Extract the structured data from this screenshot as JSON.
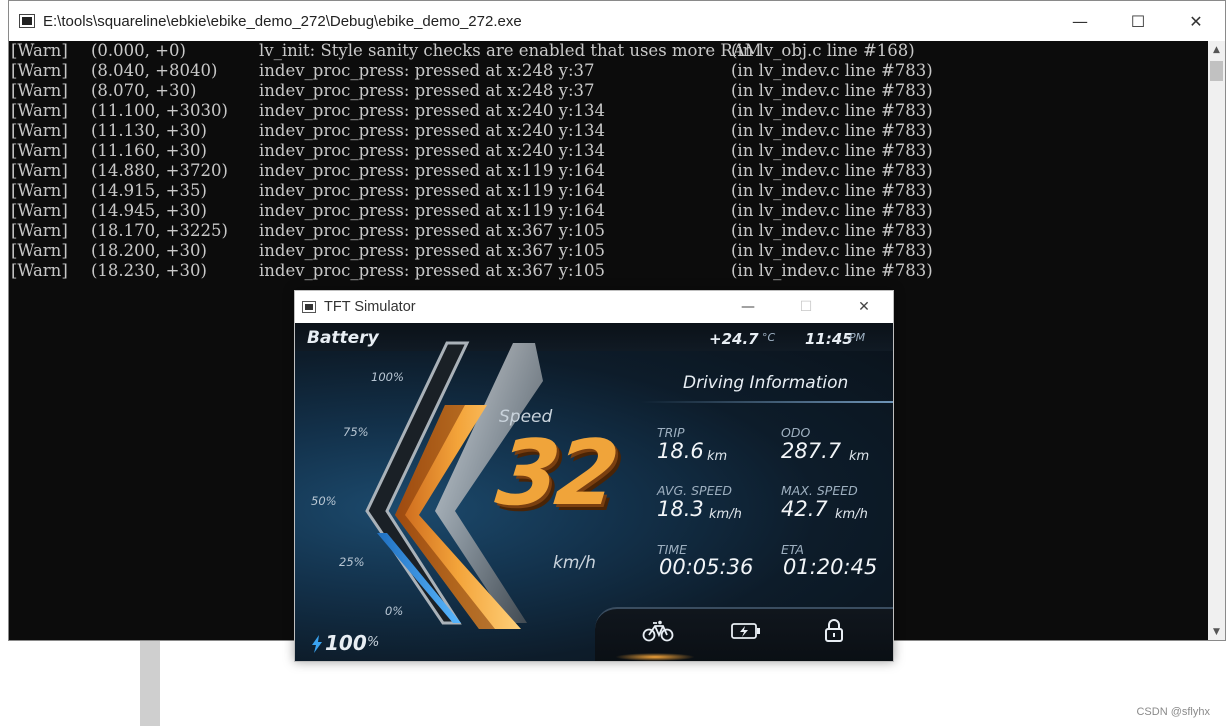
{
  "console": {
    "title": "E:\\tools\\squareline\\ebkie\\ebike_demo_272\\Debug\\ebike_demo_272.exe",
    "window_buttons": {
      "minimize": "—",
      "maximize": "☐",
      "close": "✕"
    },
    "lines": [
      {
        "level": "[Warn]",
        "time": "(0.000, +0)",
        "msg": "lv_init: Style sanity checks are enabled that uses more RAM",
        "loc": "(in lv_obj.c line #168)"
      },
      {
        "level": "[Warn]",
        "time": "(8.040, +8040)",
        "msg": "indev_proc_press: pressed at x:248 y:37",
        "loc": "(in lv_indev.c line #783)"
      },
      {
        "level": "[Warn]",
        "time": "(8.070, +30)",
        "msg": "indev_proc_press: pressed at x:248 y:37",
        "loc": "(in lv_indev.c line #783)"
      },
      {
        "level": "[Warn]",
        "time": "(11.100, +3030)",
        "msg": "indev_proc_press: pressed at x:240 y:134",
        "loc": "(in lv_indev.c line #783)"
      },
      {
        "level": "[Warn]",
        "time": "(11.130, +30)",
        "msg": "indev_proc_press: pressed at x:240 y:134",
        "loc": "(in lv_indev.c line #783)"
      },
      {
        "level": "[Warn]",
        "time": "(11.160, +30)",
        "msg": "indev_proc_press: pressed at x:240 y:134",
        "loc": "(in lv_indev.c line #783)"
      },
      {
        "level": "[Warn]",
        "time": "(14.880, +3720)",
        "msg": "indev_proc_press: pressed at x:119 y:164",
        "loc": "(in lv_indev.c line #783)"
      },
      {
        "level": "[Warn]",
        "time": "(14.915, +35)",
        "msg": "indev_proc_press: pressed at x:119 y:164",
        "loc": "(in lv_indev.c line #783)"
      },
      {
        "level": "[Warn]",
        "time": "(14.945, +30)",
        "msg": "indev_proc_press: pressed at x:119 y:164",
        "loc": "(in lv_indev.c line #783)"
      },
      {
        "level": "[Warn]",
        "time": "(18.170, +3225)",
        "msg": "indev_proc_press: pressed at x:367 y:105",
        "loc": "(in lv_indev.c line #783)"
      },
      {
        "level": "[Warn]",
        "time": "(18.200, +30)",
        "msg": "indev_proc_press: pressed at x:367 y:105",
        "loc": "(in lv_indev.c line #783)"
      },
      {
        "level": "[Warn]",
        "time": "(18.230, +30)",
        "msg": "indev_proc_press: pressed at x:367 y:105",
        "loc": "(in lv_indev.c line #783)"
      }
    ]
  },
  "simulator": {
    "title": "TFT Simulator",
    "window_buttons": {
      "minimize": "—",
      "maximize": "☐",
      "close": "✕"
    },
    "battery_title": "Battery",
    "temperature": "+24.7",
    "temperature_unit": "°C",
    "clock": "11:45",
    "clock_ampm": "PM",
    "driving_title": "Driving Information",
    "battery_scale": [
      "100%",
      "75%",
      "50%",
      "25%",
      "0%"
    ],
    "battery_level_percent": 30,
    "speed_label": "Speed",
    "speed_value": "32",
    "speed_unit": "km/h",
    "stats": {
      "trip": {
        "label": "TRIP",
        "value": "18.6",
        "unit": "km"
      },
      "odo": {
        "label": "ODO",
        "value": "287.7",
        "unit": "km"
      },
      "avg": {
        "label": "AVG. SPEED",
        "value": "18.3",
        "unit": "km/h"
      },
      "max": {
        "label": "MAX. SPEED",
        "value": "42.7",
        "unit": "km/h"
      },
      "time": {
        "label": "TIME",
        "value": "00:05:36"
      },
      "eta": {
        "label": "ETA",
        "value": "01:20:45"
      }
    },
    "battery_percent": "100",
    "battery_percent_symbol": "%",
    "nav": [
      "bicycle-icon",
      "battery-charging-icon",
      "lock-icon"
    ],
    "colors": {
      "accent_orange": "#f0a43a",
      "battery_blue": "#3aa3f0",
      "background": "#0d1c2a"
    }
  },
  "watermark": "CSDN @sflyhx"
}
